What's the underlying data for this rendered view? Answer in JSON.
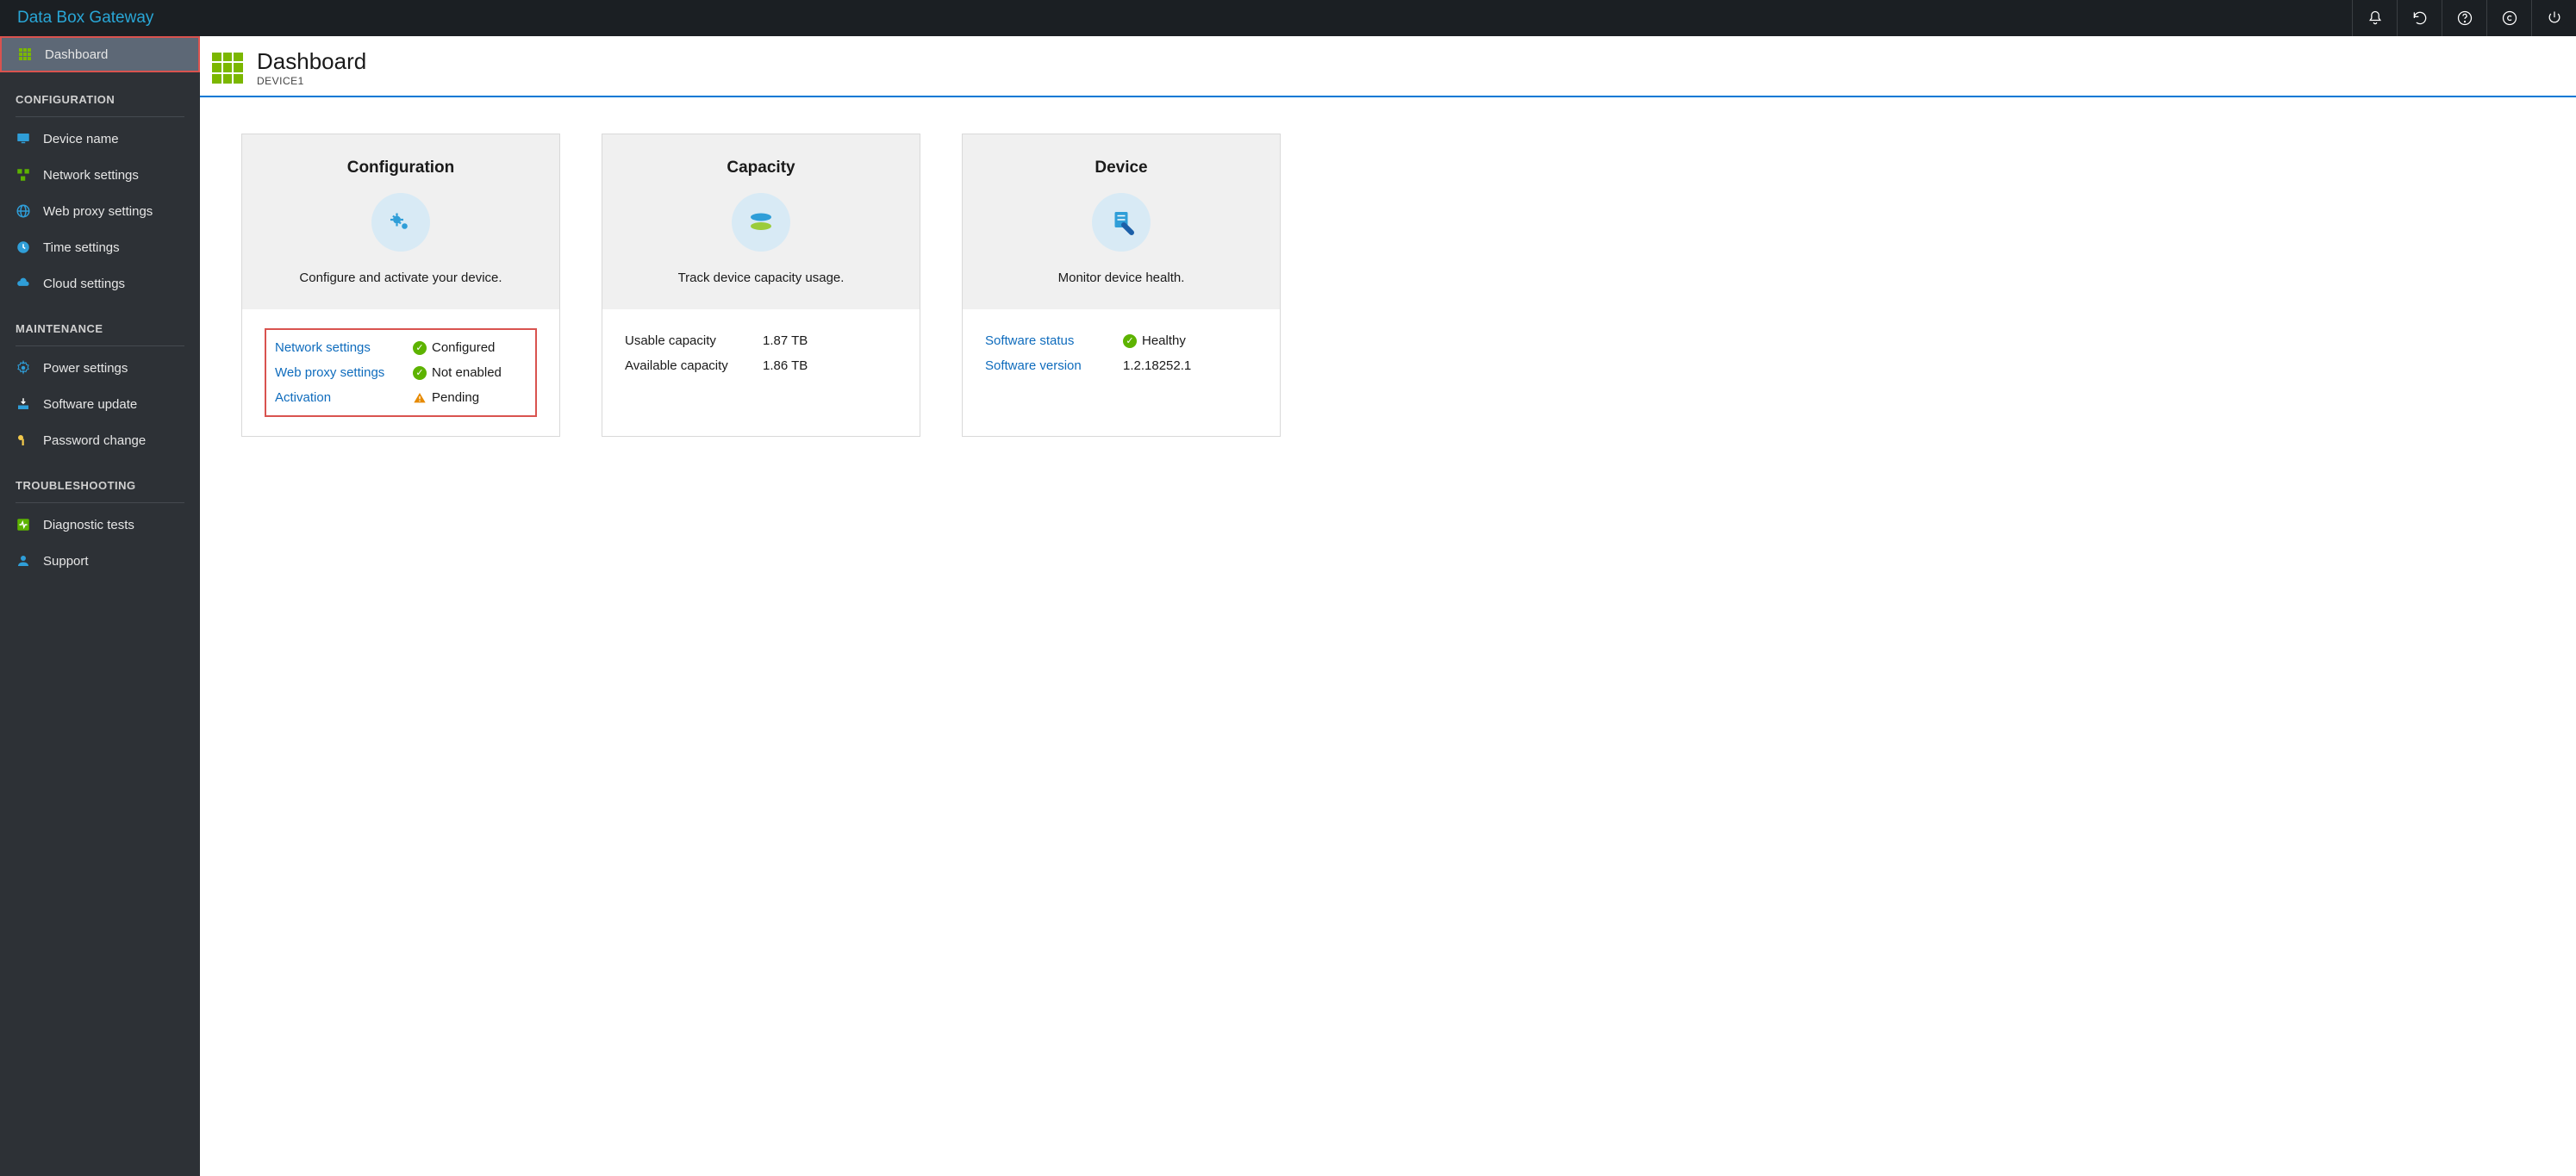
{
  "app_title": "Data Box Gateway",
  "sidebar": {
    "dashboard_label": "Dashboard",
    "sections": {
      "configuration": {
        "header": "CONFIGURATION",
        "items": {
          "device_name": "Device name",
          "network_settings": "Network settings",
          "web_proxy_settings": "Web proxy settings",
          "time_settings": "Time settings",
          "cloud_settings": "Cloud settings"
        }
      },
      "maintenance": {
        "header": "MAINTENANCE",
        "items": {
          "power_settings": "Power settings",
          "software_update": "Software update",
          "password_change": "Password change"
        }
      },
      "troubleshooting": {
        "header": "TROUBLESHOOTING",
        "items": {
          "diagnostic_tests": "Diagnostic tests",
          "support": "Support"
        }
      }
    }
  },
  "page": {
    "title": "Dashboard",
    "device": "DEVICE1"
  },
  "cards": {
    "configuration": {
      "title": "Configuration",
      "desc": "Configure and activate your device.",
      "rows": {
        "network": {
          "label": "Network settings",
          "status": "ok",
          "value": "Configured"
        },
        "webproxy": {
          "label": "Web proxy settings",
          "status": "ok",
          "value": "Not enabled"
        },
        "activation": {
          "label": "Activation",
          "status": "warn",
          "value": "Pending"
        }
      }
    },
    "capacity": {
      "title": "Capacity",
      "desc": "Track device capacity usage.",
      "rows": {
        "usable": {
          "label": "Usable capacity",
          "value": "1.87 TB"
        },
        "available": {
          "label": "Available capacity",
          "value": "1.86 TB"
        }
      }
    },
    "device": {
      "title": "Device",
      "desc": "Monitor device health.",
      "rows": {
        "software_status": {
          "label": "Software status",
          "status": "ok",
          "value": "Healthy"
        },
        "software_version": {
          "label": "Software version",
          "value": "1.2.18252.1"
        }
      }
    }
  }
}
